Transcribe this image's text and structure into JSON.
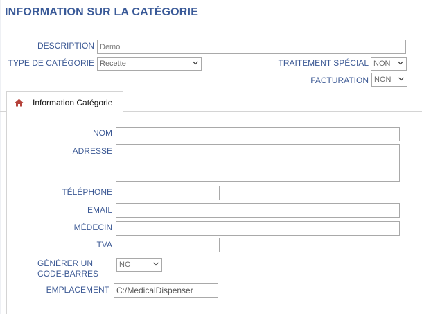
{
  "header": {
    "title": "INFORMATION SUR LA CATÉGORIE"
  },
  "form": {
    "description_label": "DESCRIPTION",
    "description_value": "Demo",
    "type_label": "TYPE DE CATÉGORIE",
    "type_value": "Recette",
    "special_label": "TRAITEMENT SPÉCIAL",
    "special_value": "NON",
    "billing_label": "FACTURATION",
    "billing_value": "NON"
  },
  "tabs": [
    {
      "label": "Information Catégorie",
      "icon": "home-icon",
      "active": true
    }
  ],
  "details": {
    "name_label": "NOM",
    "name_value": "",
    "address_label": "ADRESSE",
    "address_value": "",
    "phone_label": "TÉLÉPHONE",
    "phone_value": "",
    "email_label": "EMAIL",
    "email_value": "",
    "doctor_label": "MÉDECIN",
    "doctor_value": "",
    "vat_label": "TVA",
    "vat_value": "",
    "barcode_label_1": "GÉNÉRER UN",
    "barcode_label_2": "CODE-BARRES",
    "barcode_value": "NO",
    "location_label": "EMPLACEMENT",
    "location_value": "C:/MedicalDispenser"
  },
  "colors": {
    "title": "#3a5a98",
    "label": "#3d5a95",
    "home_icon": "#b5423a",
    "border": "#a9a9a9"
  }
}
